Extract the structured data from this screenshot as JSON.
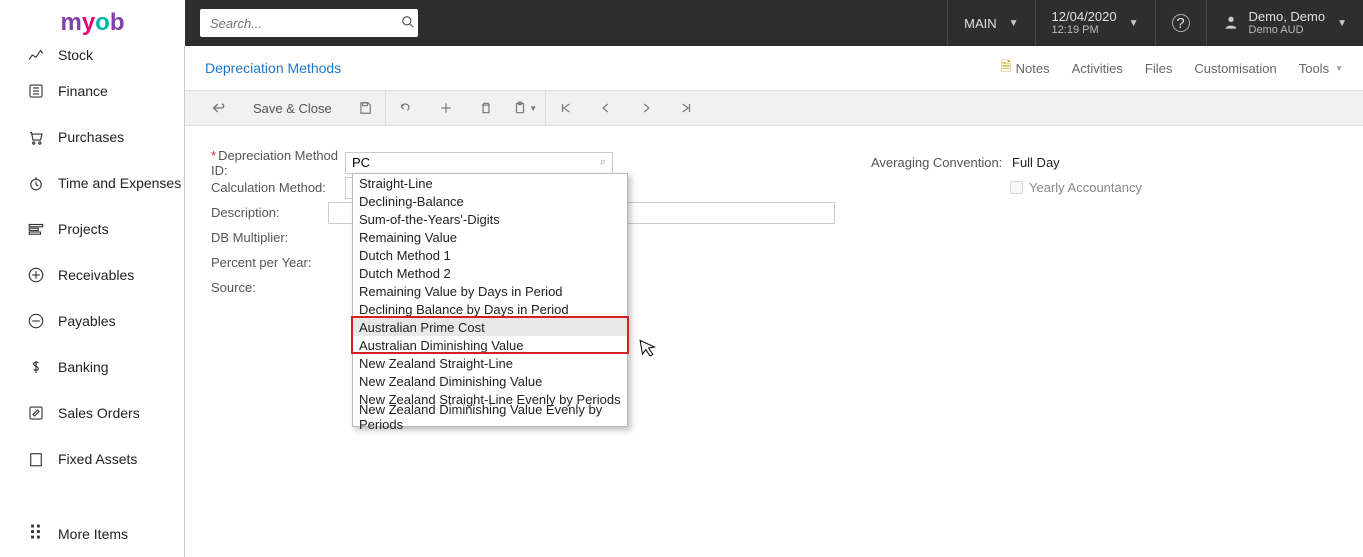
{
  "brand": {
    "m1": "m",
    "m2": "y",
    "m3": "o",
    "m4": "b"
  },
  "topbar": {
    "search_placeholder": "Search...",
    "company": "MAIN",
    "date": "12/04/2020",
    "time": "12:19 PM",
    "user_name": "Demo, Demo",
    "user_sub": "Demo AUD"
  },
  "sidebar": {
    "items": [
      {
        "label": "Stock"
      },
      {
        "label": "Finance"
      },
      {
        "label": "Purchases"
      },
      {
        "label": "Time and Expenses"
      },
      {
        "label": "Projects"
      },
      {
        "label": "Receivables"
      },
      {
        "label": "Payables"
      },
      {
        "label": "Banking"
      },
      {
        "label": "Sales Orders"
      },
      {
        "label": "Fixed Assets"
      }
    ],
    "more": "More Items"
  },
  "header": {
    "title": "Depreciation Methods",
    "notes": "Notes",
    "activities": "Activities",
    "files": "Files",
    "customisation": "Customisation",
    "tools": "Tools"
  },
  "toolbar": {
    "save_close": "Save & Close"
  },
  "form": {
    "labels": {
      "dep_method_id": "Depreciation Method ID:",
      "calc_method": "Calculation Method:",
      "description": "Description:",
      "db_multiplier": "DB Multiplier:",
      "percent_per_year": "Percent per Year:",
      "source": "Source:",
      "averaging": "Averaging Convention:",
      "yearly": "Yearly Accountancy"
    },
    "values": {
      "dep_method_id": "PC",
      "calc_method": "Australian Prime Cost",
      "averaging": "Full Day"
    }
  },
  "dropdown": {
    "options": [
      "Straight-Line",
      "Declining-Balance",
      "Sum-of-the-Years'-Digits",
      "Remaining Value",
      "Dutch Method 1",
      "Dutch Method 2",
      "Remaining Value by Days in Period",
      "Declining Balance by Days in Period",
      "Australian Prime Cost",
      "Australian Diminishing Value",
      "New Zealand Straight-Line",
      "New Zealand Diminishing Value",
      "New Zealand Straight-Line Evenly by Periods",
      "New Zealand Diminishing Value Evenly by Periods"
    ]
  }
}
